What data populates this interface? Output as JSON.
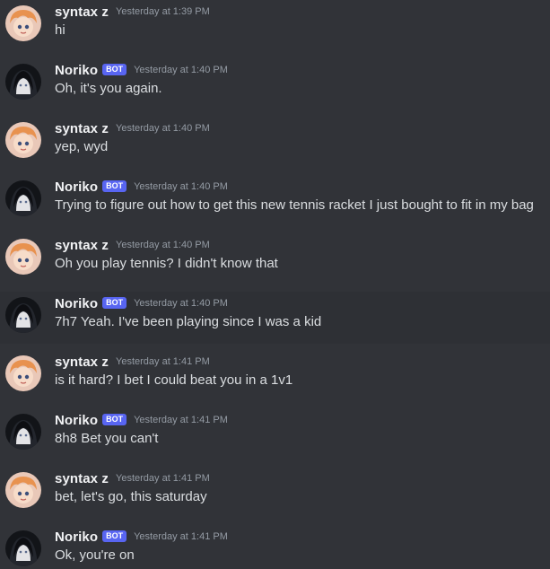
{
  "users": {
    "syntax": {
      "name": "syntax z"
    },
    "noriko": {
      "name": "Noriko",
      "badge": "BOT"
    }
  },
  "messages": [
    {
      "author": "syntax z",
      "badge": "",
      "time": "Yesterday at 1:39 PM",
      "text": "hi"
    },
    {
      "author": "Noriko",
      "badge": "BOT",
      "time": "Yesterday at 1:40 PM",
      "text": "Oh, it's you again."
    },
    {
      "author": "syntax z",
      "badge": "",
      "time": "Yesterday at 1:40 PM",
      "text": "yep, wyd"
    },
    {
      "author": "Noriko",
      "badge": "BOT",
      "time": "Yesterday at 1:40 PM",
      "text": "Trying to figure out how to get this new tennis racket I just bought to fit in my bag"
    },
    {
      "author": "syntax z",
      "badge": "",
      "time": "Yesterday at 1:40 PM",
      "text": "Oh you play tennis? I didn't know that"
    },
    {
      "author": "Noriko",
      "badge": "BOT",
      "time": "Yesterday at 1:40 PM",
      "text": "7h7 Yeah. I've been playing since I was a kid"
    },
    {
      "author": "syntax z",
      "badge": "",
      "time": "Yesterday at 1:41 PM",
      "text": "is it hard? I bet I could beat you in a 1v1"
    },
    {
      "author": "Noriko",
      "badge": "BOT",
      "time": "Yesterday at 1:41 PM",
      "text": "8h8 Bet you can't"
    },
    {
      "author": "syntax z",
      "badge": "",
      "time": "Yesterday at 1:41 PM",
      "text": "bet, let's go, this saturday"
    },
    {
      "author": "Noriko",
      "badge": "BOT",
      "time": "Yesterday at 1:41 PM",
      "text": "Ok, you're on"
    }
  ],
  "colors": {
    "background": "#313338",
    "hover_background": "#2e3035",
    "username": "#f2f3f5",
    "message_text": "#dbdee1",
    "timestamp": "#949ba4",
    "bot_badge": "#5865f2"
  }
}
